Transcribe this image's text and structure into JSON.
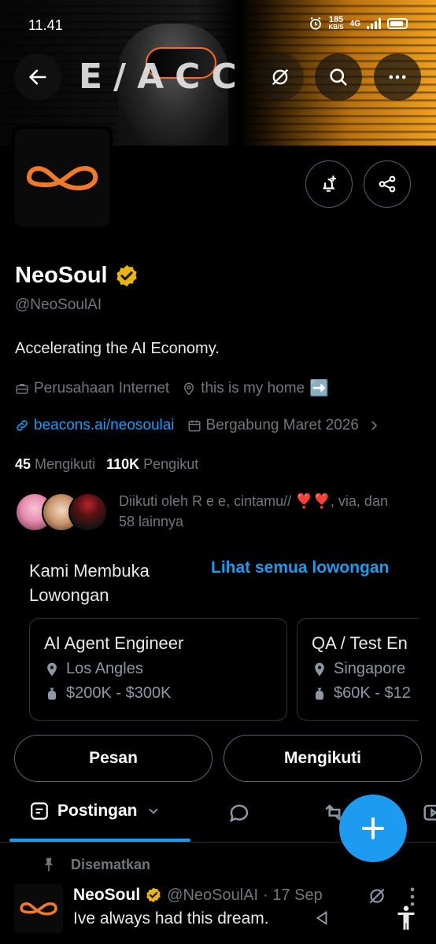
{
  "status_bar": {
    "time": "11.41",
    "speed_value": "185",
    "speed_unit": "KB/S",
    "network": "4G"
  },
  "banner": {
    "brand_text": "E/ACC"
  },
  "profile": {
    "name": "NeoSoul",
    "handle": "@NeoSoulAI",
    "bio": "Accelerating the AI Economy.",
    "category": "Perusahaan Internet",
    "location": "this is my home",
    "location_emoji": "➡️",
    "website": "beacons.ai/neosoulai",
    "joined": "Bergabung Maret 2026",
    "following_count": "45",
    "following_label": "Mengikuti",
    "followers_count": "110K",
    "followers_label": "Pengikut",
    "followed_by": "Diikuti oleh R e e, cintamu// ❣️❣️, via, dan 58 lainnya"
  },
  "jobs": {
    "title": "Kami Membuka Lowongan",
    "see_all": "Lihat semua lowongan",
    "items": [
      {
        "title": "AI Agent Engineer",
        "location": "Los Angles",
        "salary": "$200K - $300K"
      },
      {
        "title": "QA / Test En",
        "location": "Singapore",
        "salary": "$60K - $12"
      }
    ]
  },
  "actions": {
    "message": "Pesan",
    "following": "Mengikuti"
  },
  "tabs": {
    "active": "Postingan"
  },
  "post": {
    "pinned_label": "Disematkan",
    "author": "NeoSoul",
    "handle": "@NeoSoulAI",
    "date": "· 17 Sep",
    "text": "Ive always had this dream."
  },
  "colors": {
    "accent": "#1d9bf0",
    "verified": "#e8b514",
    "logo": "#f07a2a",
    "background": "#000000",
    "muted": "#71767b"
  },
  "icons": [
    "back-arrow-icon",
    "grok-icon",
    "search-icon",
    "more-icon",
    "notify-plus-icon",
    "share-icon",
    "verified-icon",
    "briefcase-icon",
    "location-icon",
    "link-icon",
    "calendar-icon",
    "chevron-right-icon",
    "pin-icon",
    "money-bag-icon",
    "compose-plus-icon",
    "reply-icon",
    "repost-icon",
    "video-icon",
    "accessibility-icon"
  ]
}
